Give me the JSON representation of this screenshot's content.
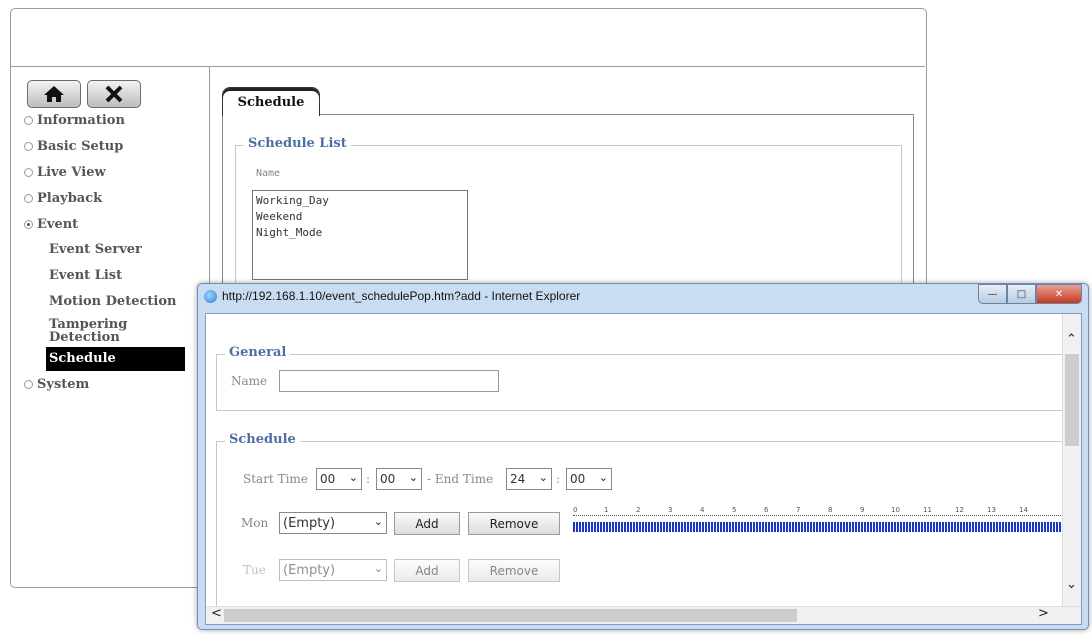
{
  "sidebar": {
    "home_icon": "home-icon",
    "tools_icon": "tools-icon",
    "items": [
      {
        "label": "Information",
        "selected": false
      },
      {
        "label": "Basic Setup",
        "selected": false
      },
      {
        "label": "Live View",
        "selected": false
      },
      {
        "label": "Playback",
        "selected": false
      },
      {
        "label": "Event",
        "selected": true
      },
      {
        "label": "System",
        "selected": false
      }
    ],
    "event_subitems": [
      "Event Server",
      "Event List",
      "Motion Detection",
      "Tampering Detection",
      "Schedule"
    ],
    "active_subitem": "Schedule"
  },
  "main": {
    "tab_label": "Schedule",
    "schedule_list": {
      "legend": "Schedule List",
      "column_header": "Name",
      "items": [
        "Working_Day",
        "Weekend",
        "Night_Mode"
      ]
    }
  },
  "popup": {
    "title": "http://192.168.1.10/event_schedulePop.htm?add - Internet Explorer",
    "general": {
      "legend": "General",
      "name_label": "Name",
      "name_value": ""
    },
    "schedule": {
      "legend": "Schedule",
      "start_time_label": "Start Time",
      "start_hour": "00",
      "start_min": "00",
      "sep1": ":",
      "dash": "- End Time",
      "end_hour": "24",
      "end_min": "00",
      "sep2": ":",
      "days": [
        {
          "day": "Mon",
          "value": "(Empty)",
          "add": "Add",
          "remove": "Remove",
          "enabled": true
        },
        {
          "day": "Tue",
          "value": "(Empty)",
          "add": "Add",
          "remove": "Remove",
          "enabled": false
        }
      ],
      "hour_ticks": [
        "0",
        "1",
        "2",
        "3",
        "4",
        "5",
        "6",
        "7",
        "8",
        "9",
        "10",
        "11",
        "12",
        "13",
        "14"
      ],
      "bar_color": "#1a36c8"
    }
  }
}
